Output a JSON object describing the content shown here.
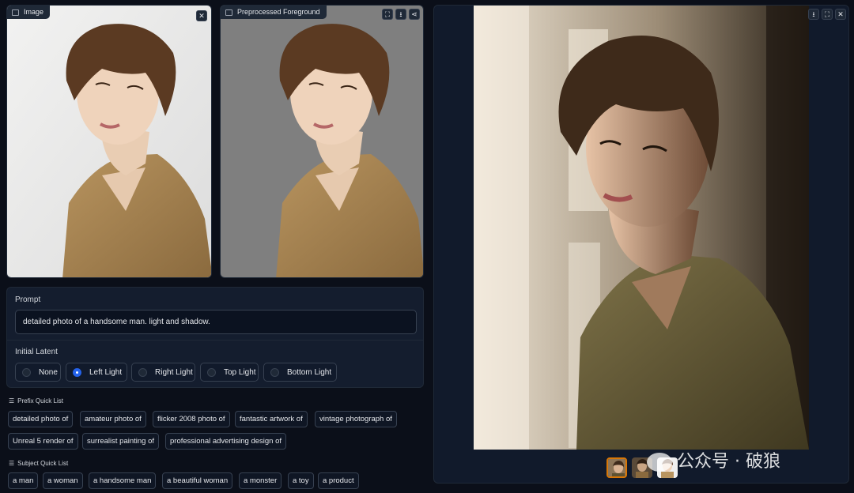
{
  "input_image": {
    "label": "Image",
    "close_icon": "✕"
  },
  "preprocessed": {
    "label": "Preprocessed Foreground",
    "buttons": [
      "⛶",
      "⭳",
      "⋖"
    ]
  },
  "prompt": {
    "label": "Prompt",
    "value": "detailed photo of a handsome man. light and shadow."
  },
  "initial_latent": {
    "label": "Initial Latent",
    "options": [
      "None",
      "Left Light",
      "Right Light",
      "Top Light",
      "Bottom Light"
    ],
    "selected": "Left Light"
  },
  "prefix_quick_list": {
    "title": "Prefix Quick List",
    "items": [
      "detailed photo of",
      "amateur photo of",
      "flicker 2008 photo of",
      "fantastic artwork of",
      "vintage photograph of",
      "Unreal 5 render of",
      "surrealist painting of",
      "professional advertising design of"
    ]
  },
  "subject_quick_list": {
    "title": "Subject Quick List",
    "items": [
      "a man",
      "a woman",
      "a handsome man",
      "a beautiful woman",
      "a monster",
      "a toy",
      "a product"
    ]
  },
  "output": {
    "buttons": [
      "⭳",
      "⛶",
      "✕"
    ]
  },
  "watermark": "公众号 · 破狼"
}
